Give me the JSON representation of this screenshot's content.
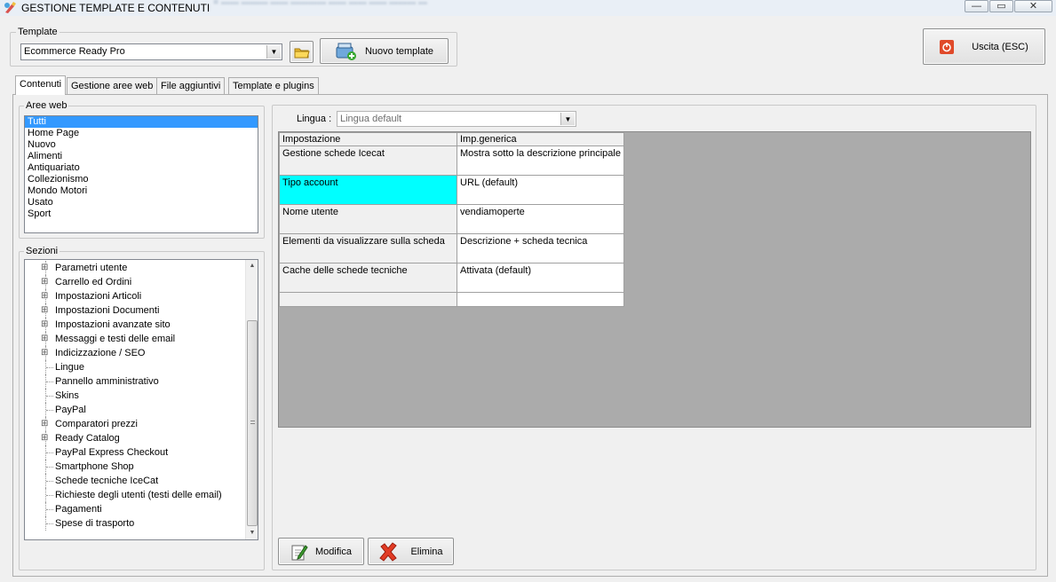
{
  "window": {
    "title": "GESTIONE TEMPLATE E CONTENUTI",
    "controls": [
      "—",
      "▭",
      "✕"
    ]
  },
  "template_group": {
    "label": "Template",
    "selected": "Ecommerce Ready Pro",
    "new_button": "Nuovo template"
  },
  "exit_button": "Uscita (ESC)",
  "tabs": [
    "Contenuti",
    "Gestione aree web",
    "File aggiuntivi",
    "Template e plugins"
  ],
  "aree_web": {
    "label": "Aree web",
    "items": [
      "Tutti",
      "Home Page",
      "Nuovo",
      "Alimenti",
      "Antiquariato",
      "Collezionismo",
      "Mondo Motori",
      "Usato",
      "Sport"
    ],
    "selected_index": 0
  },
  "sezioni": {
    "label": "Sezioni",
    "items": [
      {
        "label": "Parametri utente",
        "expandable": true
      },
      {
        "label": "Carrello ed Ordini",
        "expandable": true
      },
      {
        "label": "Impostazioni Articoli",
        "expandable": true
      },
      {
        "label": "Impostazioni Documenti",
        "expandable": true
      },
      {
        "label": "Impostazioni avanzate sito",
        "expandable": true
      },
      {
        "label": "Messaggi e testi delle email",
        "expandable": true
      },
      {
        "label": "Indicizzazione / SEO",
        "expandable": true
      },
      {
        "label": "Lingue",
        "expandable": false
      },
      {
        "label": "Pannello amministrativo",
        "expandable": false
      },
      {
        "label": "Skins",
        "expandable": false
      },
      {
        "label": "PayPal",
        "expandable": false
      },
      {
        "label": "Comparatori prezzi",
        "expandable": true
      },
      {
        "label": "Ready Catalog",
        "expandable": true
      },
      {
        "label": "PayPal Express Checkout",
        "expandable": false
      },
      {
        "label": "Smartphone Shop",
        "expandable": false
      },
      {
        "label": "Schede tecniche IceCat",
        "expandable": false
      },
      {
        "label": "Richieste degli utenti (testi delle email)",
        "expandable": false
      },
      {
        "label": "Pagamenti",
        "expandable": false
      },
      {
        "label": "Spese di trasporto",
        "expandable": false
      }
    ]
  },
  "lingua": {
    "label": "Lingua :",
    "selected": "Lingua default"
  },
  "grid": {
    "headers": [
      "Impostazione",
      "Imp.generica"
    ],
    "rows": [
      {
        "key": "Gestione schede Icecat",
        "value": "Mostra sotto la descrizione principale",
        "highlight": false
      },
      {
        "key": "Tipo account",
        "value": "URL (default)",
        "highlight": true
      },
      {
        "key": "Nome utente",
        "value": "vendiamoperte",
        "highlight": false
      },
      {
        "key": "Elementi da visualizzare sulla scheda",
        "value": "Descrizione + scheda tecnica",
        "highlight": false
      },
      {
        "key": "Cache delle schede tecniche",
        "value": "Attivata (default)",
        "highlight": false
      }
    ]
  },
  "actions": {
    "modifica": "Modifica",
    "elimina": "Elimina"
  },
  "colors": {
    "selection": "#3399ff",
    "highlight_cell": "#00ffff",
    "grid_background": "#ababab"
  }
}
